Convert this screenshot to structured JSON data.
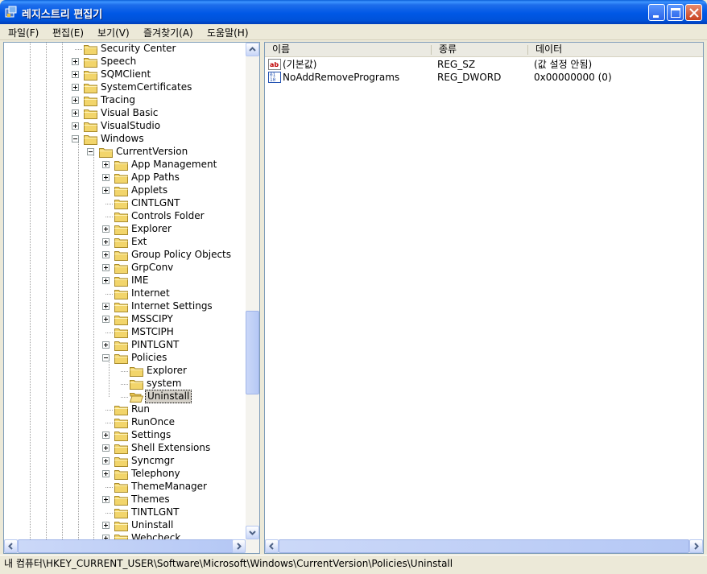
{
  "window": {
    "title": "레지스트리 편집기",
    "minimize_icon": "minimize-icon",
    "maximize_icon": "maximize-icon",
    "close_icon": "close-icon"
  },
  "menu": [
    {
      "label": "파일(F)"
    },
    {
      "label": "편집(E)"
    },
    {
      "label": "보기(V)"
    },
    {
      "label": "즐겨찾기(A)"
    },
    {
      "label": "도움말(H)"
    }
  ],
  "tree": [
    {
      "label": "Security Center",
      "depth": 0,
      "expander": "none"
    },
    {
      "label": "Speech",
      "depth": 0,
      "expander": "plus"
    },
    {
      "label": "SQMClient",
      "depth": 0,
      "expander": "plus"
    },
    {
      "label": "SystemCertificates",
      "depth": 0,
      "expander": "plus"
    },
    {
      "label": "Tracing",
      "depth": 0,
      "expander": "plus"
    },
    {
      "label": "Visual Basic",
      "depth": 0,
      "expander": "plus"
    },
    {
      "label": "VisualStudio",
      "depth": 0,
      "expander": "plus"
    },
    {
      "label": "Windows",
      "depth": 0,
      "expander": "minus"
    },
    {
      "label": "CurrentVersion",
      "depth": 1,
      "expander": "minus"
    },
    {
      "label": "App Management",
      "depth": 2,
      "expander": "plus"
    },
    {
      "label": "App Paths",
      "depth": 2,
      "expander": "plus"
    },
    {
      "label": "Applets",
      "depth": 2,
      "expander": "plus"
    },
    {
      "label": "CINTLGNT",
      "depth": 2,
      "expander": "none"
    },
    {
      "label": "Controls Folder",
      "depth": 2,
      "expander": "none"
    },
    {
      "label": "Explorer",
      "depth": 2,
      "expander": "plus"
    },
    {
      "label": "Ext",
      "depth": 2,
      "expander": "plus"
    },
    {
      "label": "Group Policy Objects",
      "depth": 2,
      "expander": "plus"
    },
    {
      "label": "GrpConv",
      "depth": 2,
      "expander": "plus"
    },
    {
      "label": "IME",
      "depth": 2,
      "expander": "plus"
    },
    {
      "label": "Internet",
      "depth": 2,
      "expander": "none"
    },
    {
      "label": "Internet Settings",
      "depth": 2,
      "expander": "plus"
    },
    {
      "label": "MSSCIPY",
      "depth": 2,
      "expander": "plus"
    },
    {
      "label": "MSTCIPH",
      "depth": 2,
      "expander": "none"
    },
    {
      "label": "PINTLGNT",
      "depth": 2,
      "expander": "plus"
    },
    {
      "label": "Policies",
      "depth": 2,
      "expander": "minus"
    },
    {
      "label": "Explorer",
      "depth": 3,
      "expander": "none"
    },
    {
      "label": "system",
      "depth": 3,
      "expander": "none"
    },
    {
      "label": "Uninstall",
      "depth": 3,
      "expander": "none",
      "selected": true
    },
    {
      "label": "Run",
      "depth": 2,
      "expander": "none"
    },
    {
      "label": "RunOnce",
      "depth": 2,
      "expander": "none"
    },
    {
      "label": "Settings",
      "depth": 2,
      "expander": "plus"
    },
    {
      "label": "Shell Extensions",
      "depth": 2,
      "expander": "plus"
    },
    {
      "label": "Syncmgr",
      "depth": 2,
      "expander": "plus"
    },
    {
      "label": "Telephony",
      "depth": 2,
      "expander": "plus"
    },
    {
      "label": "ThemeManager",
      "depth": 2,
      "expander": "none"
    },
    {
      "label": "Themes",
      "depth": 2,
      "expander": "plus"
    },
    {
      "label": "TINTLGNT",
      "depth": 2,
      "expander": "none"
    },
    {
      "label": "Uninstall",
      "depth": 2,
      "expander": "plus"
    },
    {
      "label": "Webcheck",
      "depth": 2,
      "expander": "plus"
    }
  ],
  "list": {
    "columns": [
      "이름",
      "종류",
      "데이터"
    ],
    "rows": [
      {
        "name": "(기본값)",
        "type": "REG_SZ",
        "data": "(값 설정 안됨)",
        "icon": "string-value-icon"
      },
      {
        "name": "NoAddRemovePrograms",
        "type": "REG_DWORD",
        "data": "0x00000000 (0)",
        "icon": "binary-value-icon"
      }
    ]
  },
  "status": {
    "path": "내 컴퓨터\\HKEY_CURRENT_USER\\Software\\Microsoft\\Windows\\CurrentVersion\\Policies\\Uninstall"
  },
  "colors": {
    "titlebar": "#0058E6",
    "folder": "#F2D56B",
    "selection": "#D4D0C8"
  }
}
